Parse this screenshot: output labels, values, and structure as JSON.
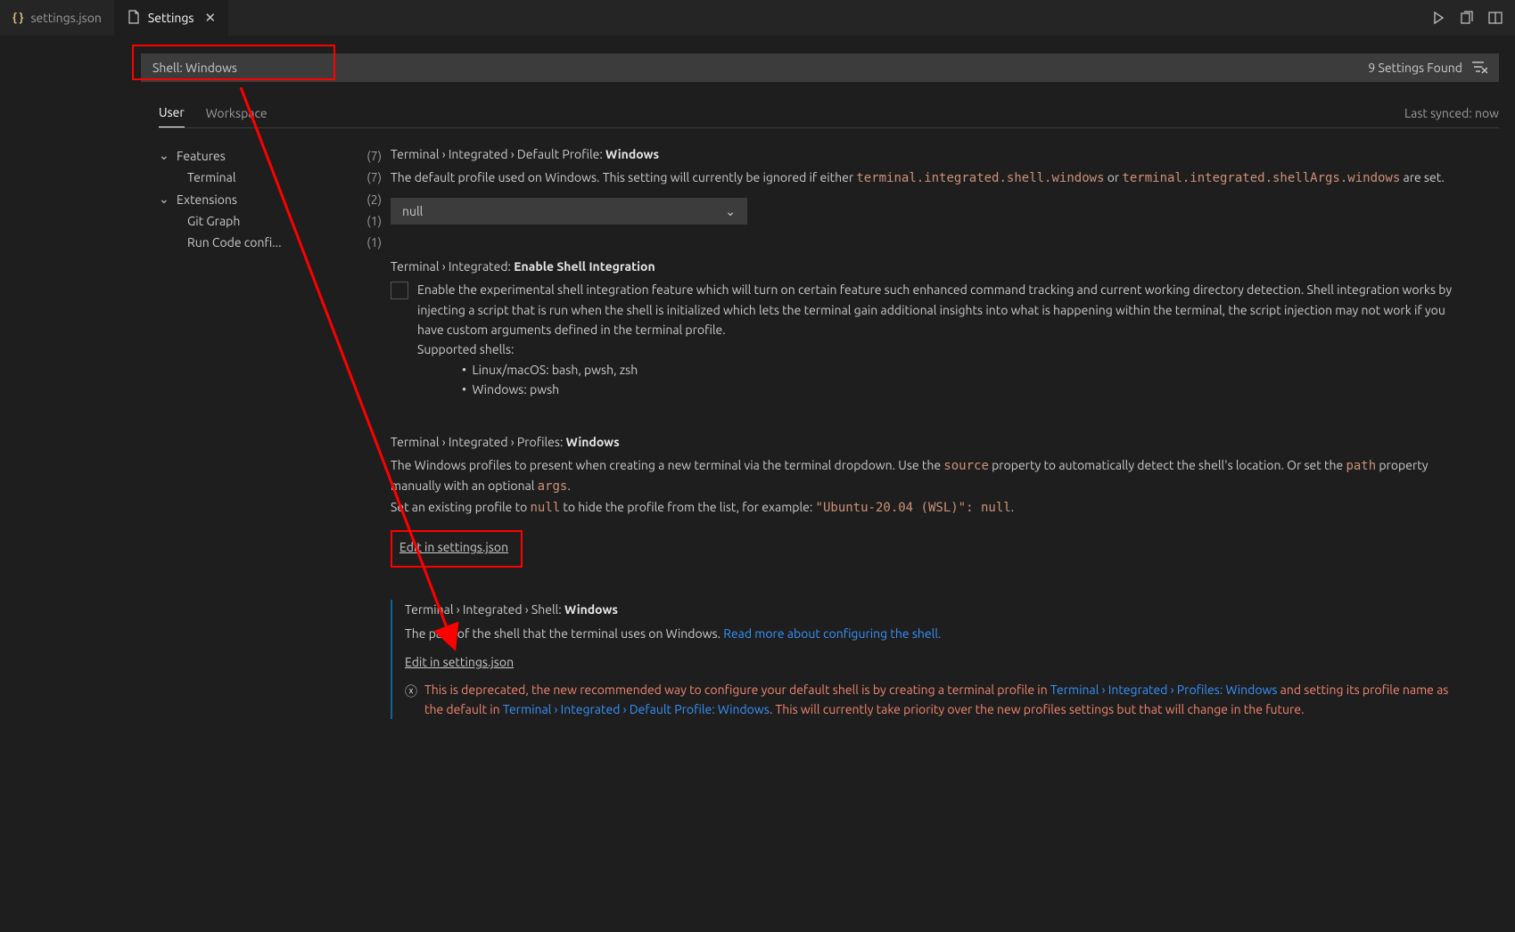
{
  "tabs": {
    "inactive_label": "settings.json",
    "active_label": "Settings"
  },
  "search": {
    "value": "Shell: Windows",
    "found_label": "9 Settings Found"
  },
  "scopes": {
    "user": "User",
    "workspace": "Workspace",
    "synced": "Last synced: now"
  },
  "toc": {
    "features": {
      "label": "Features",
      "count": "(7)"
    },
    "terminal": {
      "label": "Terminal",
      "count": "(7)"
    },
    "extensions": {
      "label": "Extensions",
      "count": "(2)"
    },
    "gitgraph": {
      "label": "Git Graph",
      "count": "(1)"
    },
    "runcode": {
      "label": "Run Code confi...",
      "count": "(1)"
    }
  },
  "s1": {
    "crumb": "Terminal › Integrated › Default Profile: ",
    "crumb_strong": "Windows",
    "desc_a": "The default profile used on Windows. This setting will currently be ignored if either ",
    "code1": "terminal.integrated.shell.windows",
    "desc_b": " or ",
    "code2": "terminal.integrated.shellArgs.windows",
    "desc_c": " are set.",
    "select_val": "null"
  },
  "s2": {
    "crumb": "Terminal › Integrated: ",
    "crumb_strong": "Enable Shell Integration",
    "desc": "Enable the experimental shell integration feature which will turn on certain feature such enhanced command tracking and current working directory detection. Shell integration works by injecting a script that is run when the shell is initialized which lets the terminal gain additional insights into what is happening within the terminal, the script injection may not work if you have custom arguments defined in the terminal profile.",
    "supported": "Supported shells:",
    "b1": "Linux/macOS: bash, pwsh, zsh",
    "b2": "Windows: pwsh"
  },
  "s3": {
    "crumb": "Terminal › Integrated › Profiles: ",
    "crumb_strong": "Windows",
    "d1": "The Windows profiles to present when creating a new terminal via the terminal dropdown. Use the ",
    "code1": "source",
    "d2": " property to automatically detect the shell's location. Or set the ",
    "code2": "path",
    "d3": " property manually with an optional ",
    "code3": "args",
    "d4": ".",
    "d5": "Set an existing profile to ",
    "code4": "null",
    "d6": " to hide the profile from the list, for example: ",
    "code5": "\"Ubuntu-20.04 (WSL)\": null",
    "d7": ".",
    "edit": "Edit in settings.json"
  },
  "s4": {
    "crumb": "Terminal › Integrated › Shell: ",
    "crumb_strong": "Windows",
    "desc": "The path of the shell that the terminal uses on Windows. ",
    "link": "Read more about configuring the shell.",
    "edit": "Edit in settings.json",
    "dep1": "This is deprecated, the new recommended way to configure your default shell is by creating a terminal profile in ",
    "l1": "Terminal › Integrated › Profiles: Windows",
    "dep2": " and setting its profile name as the default in ",
    "l2": "Terminal › Integrated › Default Profile: Windows",
    "dep3": ". This will currently take priority over the new profiles settings but that will change in the future."
  }
}
